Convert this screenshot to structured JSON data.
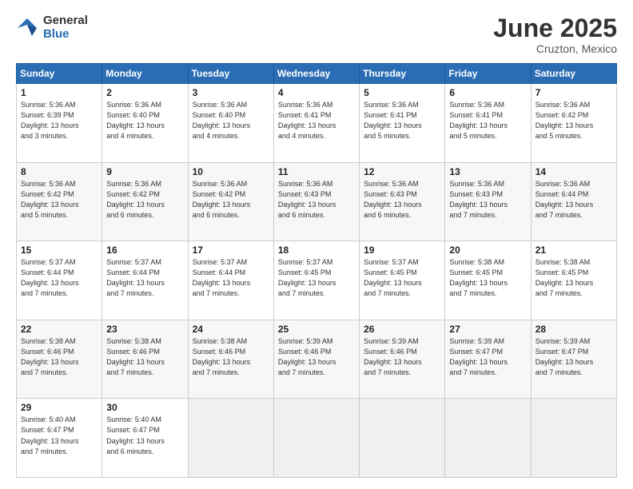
{
  "logo": {
    "general": "General",
    "blue": "Blue"
  },
  "title": "June 2025",
  "location": "Cruzton, Mexico",
  "days_header": [
    "Sunday",
    "Monday",
    "Tuesday",
    "Wednesday",
    "Thursday",
    "Friday",
    "Saturday"
  ],
  "weeks": [
    [
      {
        "day": "1",
        "info": "Sunrise: 5:36 AM\nSunset: 6:39 PM\nDaylight: 13 hours\nand 3 minutes."
      },
      {
        "day": "2",
        "info": "Sunrise: 5:36 AM\nSunset: 6:40 PM\nDaylight: 13 hours\nand 4 minutes."
      },
      {
        "day": "3",
        "info": "Sunrise: 5:36 AM\nSunset: 6:40 PM\nDaylight: 13 hours\nand 4 minutes."
      },
      {
        "day": "4",
        "info": "Sunrise: 5:36 AM\nSunset: 6:41 PM\nDaylight: 13 hours\nand 4 minutes."
      },
      {
        "day": "5",
        "info": "Sunrise: 5:36 AM\nSunset: 6:41 PM\nDaylight: 13 hours\nand 5 minutes."
      },
      {
        "day": "6",
        "info": "Sunrise: 5:36 AM\nSunset: 6:41 PM\nDaylight: 13 hours\nand 5 minutes."
      },
      {
        "day": "7",
        "info": "Sunrise: 5:36 AM\nSunset: 6:42 PM\nDaylight: 13 hours\nand 5 minutes."
      }
    ],
    [
      {
        "day": "8",
        "info": "Sunrise: 5:36 AM\nSunset: 6:42 PM\nDaylight: 13 hours\nand 5 minutes."
      },
      {
        "day": "9",
        "info": "Sunrise: 5:36 AM\nSunset: 6:42 PM\nDaylight: 13 hours\nand 6 minutes."
      },
      {
        "day": "10",
        "info": "Sunrise: 5:36 AM\nSunset: 6:42 PM\nDaylight: 13 hours\nand 6 minutes."
      },
      {
        "day": "11",
        "info": "Sunrise: 5:36 AM\nSunset: 6:43 PM\nDaylight: 13 hours\nand 6 minutes."
      },
      {
        "day": "12",
        "info": "Sunrise: 5:36 AM\nSunset: 6:43 PM\nDaylight: 13 hours\nand 6 minutes."
      },
      {
        "day": "13",
        "info": "Sunrise: 5:36 AM\nSunset: 6:43 PM\nDaylight: 13 hours\nand 7 minutes."
      },
      {
        "day": "14",
        "info": "Sunrise: 5:36 AM\nSunset: 6:44 PM\nDaylight: 13 hours\nand 7 minutes."
      }
    ],
    [
      {
        "day": "15",
        "info": "Sunrise: 5:37 AM\nSunset: 6:44 PM\nDaylight: 13 hours\nand 7 minutes."
      },
      {
        "day": "16",
        "info": "Sunrise: 5:37 AM\nSunset: 6:44 PM\nDaylight: 13 hours\nand 7 minutes."
      },
      {
        "day": "17",
        "info": "Sunrise: 5:37 AM\nSunset: 6:44 PM\nDaylight: 13 hours\nand 7 minutes."
      },
      {
        "day": "18",
        "info": "Sunrise: 5:37 AM\nSunset: 6:45 PM\nDaylight: 13 hours\nand 7 minutes."
      },
      {
        "day": "19",
        "info": "Sunrise: 5:37 AM\nSunset: 6:45 PM\nDaylight: 13 hours\nand 7 minutes."
      },
      {
        "day": "20",
        "info": "Sunrise: 5:38 AM\nSunset: 6:45 PM\nDaylight: 13 hours\nand 7 minutes."
      },
      {
        "day": "21",
        "info": "Sunrise: 5:38 AM\nSunset: 6:45 PM\nDaylight: 13 hours\nand 7 minutes."
      }
    ],
    [
      {
        "day": "22",
        "info": "Sunrise: 5:38 AM\nSunset: 6:46 PM\nDaylight: 13 hours\nand 7 minutes."
      },
      {
        "day": "23",
        "info": "Sunrise: 5:38 AM\nSunset: 6:46 PM\nDaylight: 13 hours\nand 7 minutes."
      },
      {
        "day": "24",
        "info": "Sunrise: 5:38 AM\nSunset: 6:46 PM\nDaylight: 13 hours\nand 7 minutes."
      },
      {
        "day": "25",
        "info": "Sunrise: 5:39 AM\nSunset: 6:46 PM\nDaylight: 13 hours\nand 7 minutes."
      },
      {
        "day": "26",
        "info": "Sunrise: 5:39 AM\nSunset: 6:46 PM\nDaylight: 13 hours\nand 7 minutes."
      },
      {
        "day": "27",
        "info": "Sunrise: 5:39 AM\nSunset: 6:47 PM\nDaylight: 13 hours\nand 7 minutes."
      },
      {
        "day": "28",
        "info": "Sunrise: 5:39 AM\nSunset: 6:47 PM\nDaylight: 13 hours\nand 7 minutes."
      }
    ],
    [
      {
        "day": "29",
        "info": "Sunrise: 5:40 AM\nSunset: 6:47 PM\nDaylight: 13 hours\nand 7 minutes."
      },
      {
        "day": "30",
        "info": "Sunrise: 5:40 AM\nSunset: 6:47 PM\nDaylight: 13 hours\nand 6 minutes."
      },
      {
        "day": "",
        "info": ""
      },
      {
        "day": "",
        "info": ""
      },
      {
        "day": "",
        "info": ""
      },
      {
        "day": "",
        "info": ""
      },
      {
        "day": "",
        "info": ""
      }
    ]
  ]
}
